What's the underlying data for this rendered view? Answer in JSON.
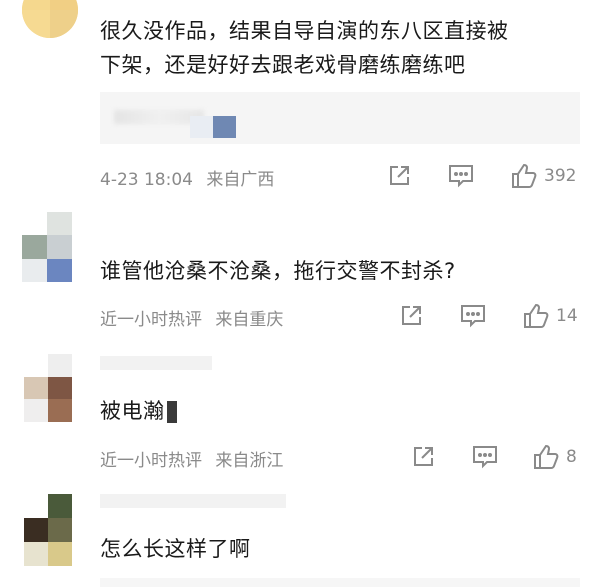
{
  "comments": [
    {
      "text_line1": "很久没作品，结果自导自演的东八区直接被",
      "text_line2": "下架，还是好好去跟老戏骨磨练磨练吧",
      "time": "4-23 18:04",
      "location": "来自广西",
      "likes": "392"
    },
    {
      "text": "谁管他沧桑不沧桑，拖行交警不封杀?",
      "time": "近一小时热评",
      "location": "来自重庆",
      "likes": "14"
    },
    {
      "text": "被电瀚",
      "time": "近一小时热评",
      "location": "来自浙江",
      "likes": "8"
    },
    {
      "text": "怎么长这样了啊"
    }
  ],
  "icons": {
    "share": "share-icon",
    "comment": "comment-icon",
    "like": "thumbs-up-icon"
  },
  "colors": {
    "text": "#1a1a1a",
    "meta": "#8a8a8a",
    "reply_bg": "#f5f5f5"
  }
}
